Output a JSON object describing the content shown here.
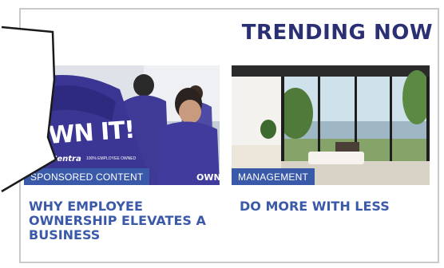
{
  "section": {
    "heading": "TRENDING NOW"
  },
  "articles": [
    {
      "category": "SPONSORED CONTENT",
      "title": "WHY EMPLOYEE OWNERSHIP ELEVATES A BUSINESS",
      "image": {
        "hoodie_text": "OWN IT!",
        "logo_text": "Centra",
        "sub_text": "100% EMPLOYEE OWNED",
        "sleeve_text": "OWN"
      }
    },
    {
      "category": "MANAGEMENT",
      "title": "DO MORE WITH LESS"
    }
  ],
  "colors": {
    "heading": "#2b2f73",
    "accent": "#3a59a8",
    "border": "#c9c9cc"
  }
}
